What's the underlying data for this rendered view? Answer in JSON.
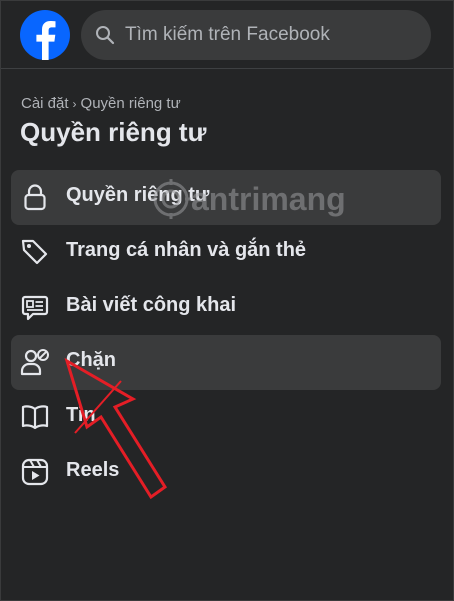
{
  "header": {
    "logo_icon": "facebook-logo-icon",
    "search_placeholder": "Tìm kiếm trên Facebook"
  },
  "breadcrumb": {
    "parent": "Cài đặt",
    "separator": "›",
    "current": "Quyền riêng tư"
  },
  "page_title": "Quyền riêng tư",
  "menu": {
    "items": [
      {
        "label": "Quyền riêng tư",
        "icon": "lock-icon",
        "active": true
      },
      {
        "label": "Trang cá nhân và gắn thẻ",
        "icon": "tag-icon",
        "active": false
      },
      {
        "label": "Bài viết công khai",
        "icon": "public-post-icon",
        "active": false
      },
      {
        "label": "Chặn",
        "icon": "block-user-icon",
        "active": true
      },
      {
        "label": "Tin",
        "icon": "book-icon",
        "active": false
      },
      {
        "label": "Reels",
        "icon": "reels-icon",
        "active": false
      }
    ]
  },
  "watermark": {
    "text_prefix": "",
    "text": "antrimang"
  },
  "colors": {
    "background": "#242526",
    "surface_active": "#3a3b3c",
    "facebook_blue": "#0866ff",
    "text_primary": "#e4e6eb",
    "text_secondary": "#b0b3b8",
    "annotation_arrow": "#e41e26"
  }
}
